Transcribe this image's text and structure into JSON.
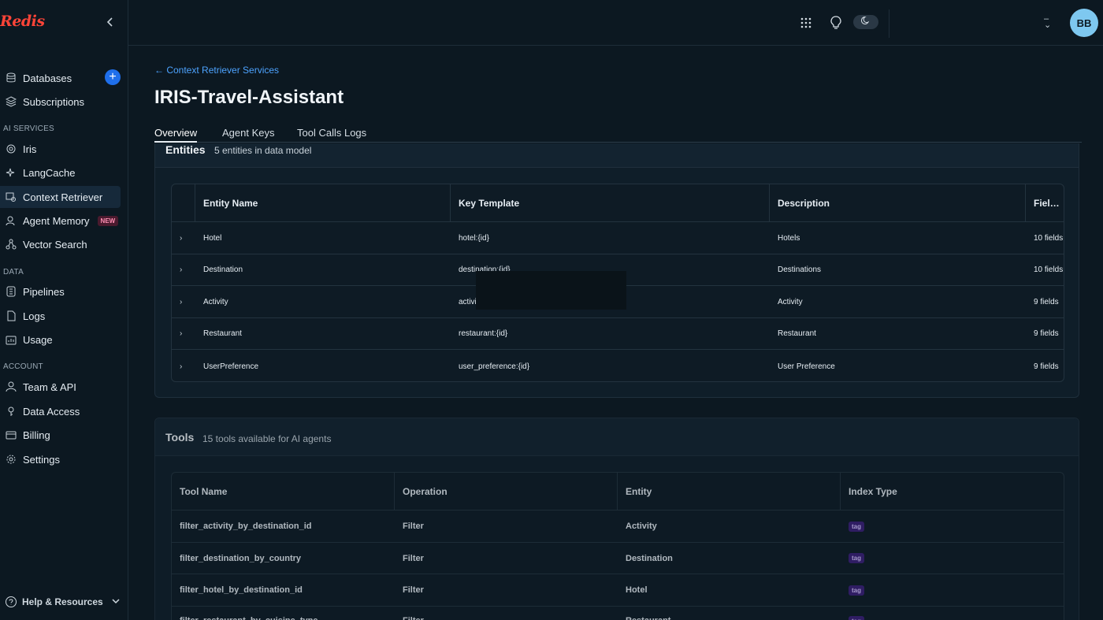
{
  "app": {
    "logo_text": "Redis"
  },
  "sidebar": {
    "items_top": [
      {
        "label": "Databases",
        "icon": "database-icon"
      },
      {
        "label": "Subscriptions",
        "icon": "layers-icon"
      }
    ],
    "section_ai": "AI SERVICES",
    "items_ai": [
      {
        "label": "Iris",
        "icon": "iris-icon"
      },
      {
        "label": "LangCache",
        "icon": "sparkle-icon"
      },
      {
        "label": "Context Retriever",
        "icon": "context-retriever-icon"
      },
      {
        "label": "Agent Memory",
        "icon": "agent-memory-icon",
        "badge": "NEW"
      },
      {
        "label": "Vector Search",
        "icon": "vector-search-icon"
      }
    ],
    "section_data": "DATA",
    "items_data": [
      {
        "label": "Pipelines",
        "icon": "pipelines-icon"
      },
      {
        "label": "Logs",
        "icon": "logs-icon"
      },
      {
        "label": "Usage",
        "icon": "usage-icon"
      }
    ],
    "section_account": "ACCOUNT",
    "items_account": [
      {
        "label": "Team & API",
        "icon": "user-icon"
      },
      {
        "label": "Data Access",
        "icon": "key-icon"
      },
      {
        "label": "Billing",
        "icon": "billing-icon"
      },
      {
        "label": "Settings",
        "icon": "gear-icon"
      }
    ],
    "help_label": "Help & Resources"
  },
  "topbar": {
    "avatar_initials": "BB"
  },
  "page": {
    "breadcrumb": "← Context Retriever Services",
    "title": "IRIS-Travel-Assistant",
    "tabs": [
      "Overview",
      "Agent Keys",
      "Tool Calls Logs"
    ],
    "active_tab": "Overview"
  },
  "entities": {
    "title": "Entities",
    "subtitle": "5 entities in data model",
    "columns": [
      "Entity Name",
      "Key Template",
      "Description",
      "Fiel…"
    ],
    "rows": [
      {
        "name": "Hotel",
        "key": "hotel:{id}",
        "description": "Hotels",
        "fields": "10 fields"
      },
      {
        "name": "Destination",
        "key": "destination:{id}",
        "description": "Destinations",
        "fields": "10 fields"
      },
      {
        "name": "Activity",
        "key": "activi",
        "description": "Activity",
        "fields": "9 fields"
      },
      {
        "name": "Restaurant",
        "key": "restaurant:{id}",
        "description": "Restaurant",
        "fields": "9 fields"
      },
      {
        "name": "UserPreference",
        "key": "user_preference:{id}",
        "description": "User Preference",
        "fields": "9 fields"
      }
    ]
  },
  "tools": {
    "title": "Tools",
    "subtitle": "15 tools available for AI agents",
    "columns": [
      "Tool Name",
      "Operation",
      "Entity",
      "Index Type"
    ],
    "rows": [
      {
        "name": "filter_activity_by_destination_id",
        "operation": "Filter",
        "entity": "Activity",
        "index": "tag"
      },
      {
        "name": "filter_destination_by_country",
        "operation": "Filter",
        "entity": "Destination",
        "index": "tag"
      },
      {
        "name": "filter_hotel_by_destination_id",
        "operation": "Filter",
        "entity": "Hotel",
        "index": "tag"
      },
      {
        "name": "filter_restaurant_by_cuisine_type",
        "operation": "Filter",
        "entity": "Restaurant",
        "index": "tag"
      }
    ]
  },
  "colors": {
    "accent": "#1f6feb",
    "brand": "#ff4438",
    "link": "#4da3ff",
    "tag_bg": "#3b1f7a"
  }
}
